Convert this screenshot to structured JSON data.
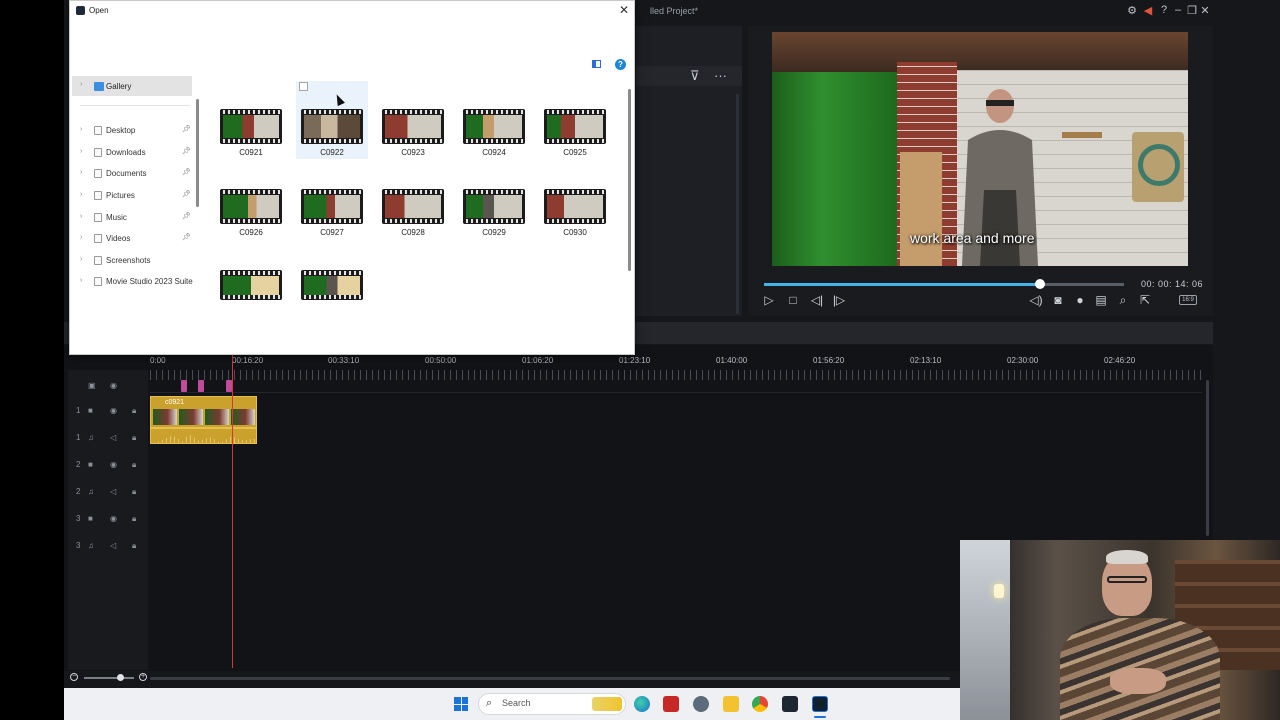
{
  "app": {
    "project_title": "lled Project*",
    "window_controls": [
      "gear-icon",
      "megaphone-icon",
      "help-icon",
      "minimize-icon",
      "restore-icon",
      "close-icon"
    ]
  },
  "preview": {
    "subtitle": "work area and more",
    "timecode": "00: 00: 14: 06",
    "progress": 0.71,
    "aspect_ratio": "16:9"
  },
  "timeline": {
    "ruler_labels": [
      "0:00",
      "00:16:20",
      "00:33:10",
      "00:50:00",
      "01:06:20",
      "01:23:10",
      "01:40:00",
      "01:56:20",
      "02:13:10",
      "02:30:00",
      "02:46:20"
    ],
    "clip_label": "c0921",
    "tracks": [
      {
        "number": "1",
        "kind": "video"
      },
      {
        "number": "1",
        "kind": "audio"
      },
      {
        "number": "2",
        "kind": "video"
      },
      {
        "number": "2",
        "kind": "audio"
      },
      {
        "number": "3",
        "kind": "video"
      },
      {
        "number": "3",
        "kind": "audio"
      }
    ]
  },
  "dialog": {
    "title": "Open",
    "close_glyph": "✕",
    "help_glyph": "?",
    "gallery_label": "Gallery",
    "nav_items": [
      {
        "label": "Desktop",
        "pinned": true
      },
      {
        "label": "Downloads",
        "pinned": true
      },
      {
        "label": "Documents",
        "pinned": true
      },
      {
        "label": "Pictures",
        "pinned": true
      },
      {
        "label": "Music",
        "pinned": true
      },
      {
        "label": "Videos",
        "pinned": true
      },
      {
        "label": "Screenshots",
        "pinned": false
      },
      {
        "label": "Movie Studio 2023 Suite",
        "pinned": false
      }
    ],
    "files": [
      "C0921",
      "C0922",
      "C0923",
      "C0924",
      "C0925",
      "C0926",
      "C0927",
      "C0928",
      "C0929",
      "C0930",
      "",
      ""
    ]
  },
  "taskbar": {
    "search_placeholder": "Search",
    "icons": [
      "windows-start-icon",
      "edge-icon",
      "mcafee-icon",
      "settings-icon",
      "file-explorer-icon",
      "chrome-icon",
      "video-editor-icon",
      "powerdirector-icon"
    ]
  }
}
